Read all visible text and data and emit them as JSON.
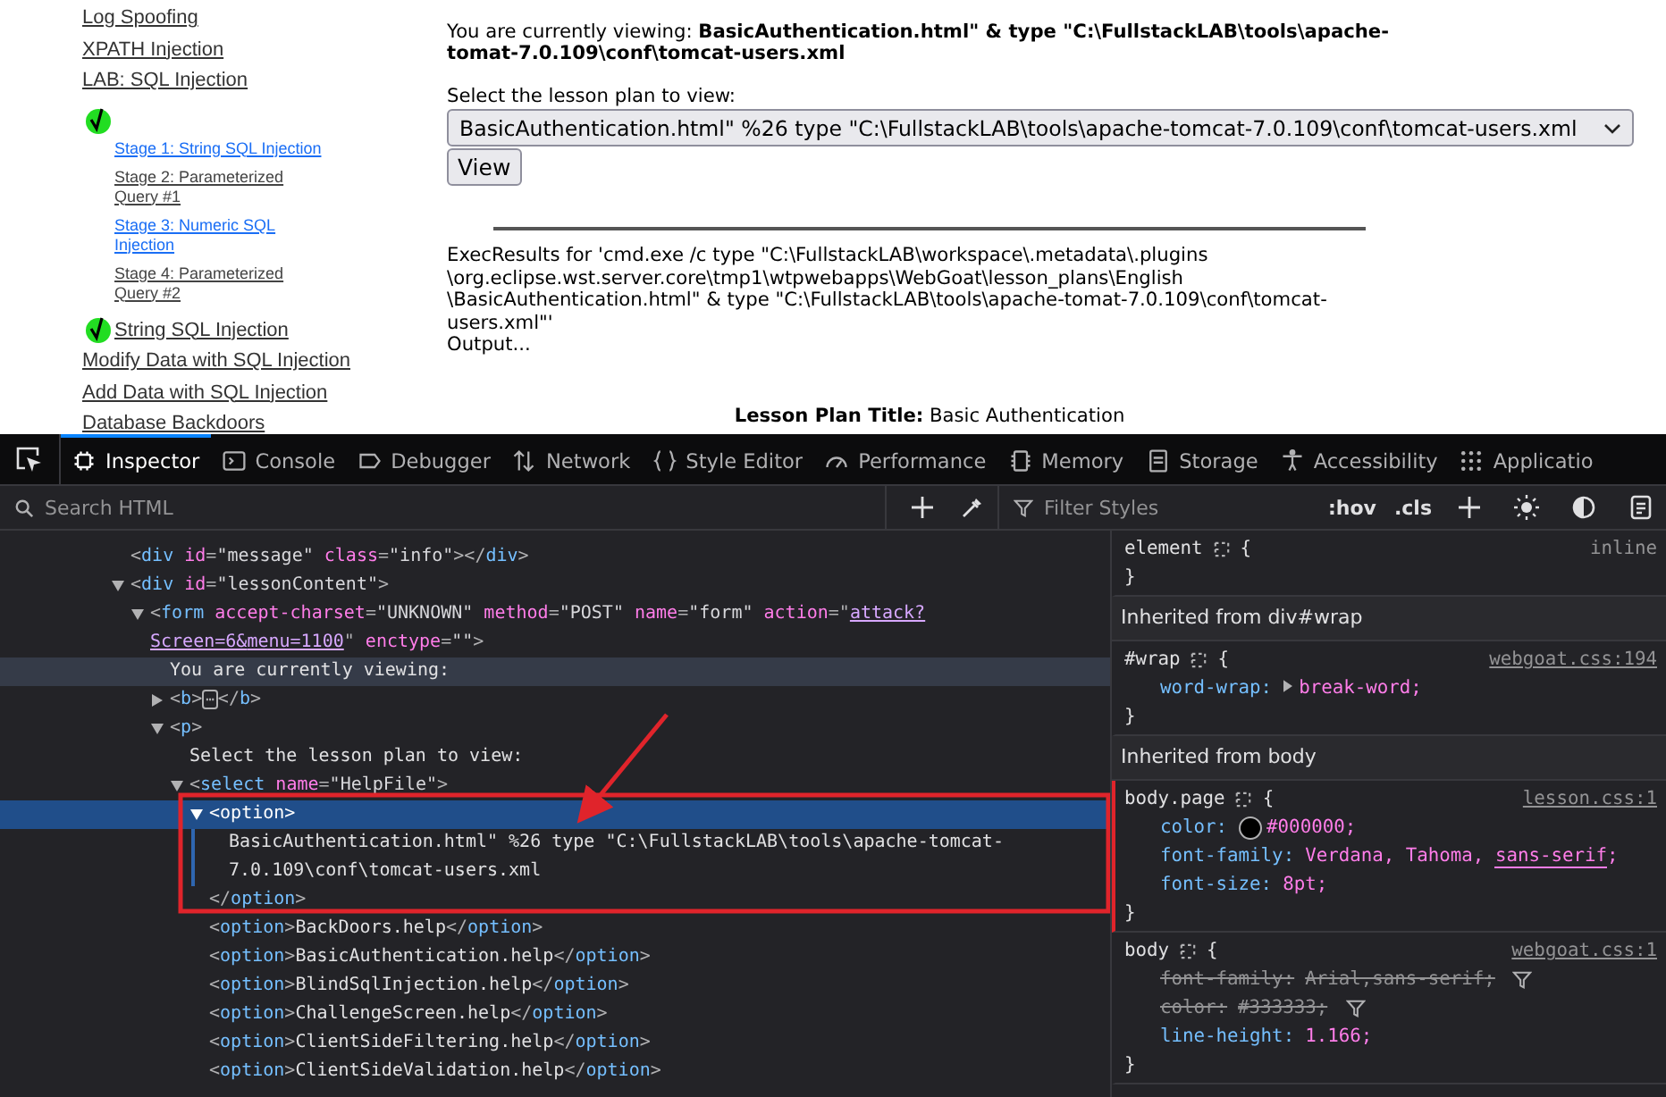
{
  "lesson_nav": {
    "items": [
      {
        "label": "Log Spoofing",
        "completed": false
      },
      {
        "label": "XPATH Injection",
        "completed": false
      },
      {
        "label": "LAB: SQL Injection",
        "completed": true,
        "children": [
          {
            "label": "Stage 1: String SQL Injection",
            "visited": false
          },
          {
            "label": "Stage 2: Parameterized Query #1",
            "visited": true
          },
          {
            "label": "Stage 3: Numeric SQL Injection",
            "visited": false
          },
          {
            "label": "Stage 4: Parameterized Query #2",
            "visited": true
          }
        ]
      },
      {
        "label": "String SQL Injection",
        "completed": true
      },
      {
        "label": "Modify Data with SQL Injection",
        "completed": false
      },
      {
        "label": "Add Data with SQL Injection",
        "completed": false
      },
      {
        "label": "Database Backdoors",
        "completed": false
      }
    ]
  },
  "lesson": {
    "viewing_label": "You are currently viewing:",
    "viewing_value": "BasicAuthentication.html\" & type \"C:\\FullstackLAB\\tools\\apache-tomat-7.0.109\\conf\\tomcat-users.xml",
    "select_label": "Select the lesson plan to view:",
    "select_value": "BasicAuthentication.html\" %26 type \"C:\\FullstackLAB\\tools\\apache-tomcat-7.0.109\\conf\\tomcat-users.xml",
    "view_button": "View",
    "exec_results": "ExecResults for 'cmd.exe /c type \"C:\\FullstackLAB\\workspace\\.metadata\\.plugins \\org.eclipse.wst.server.core\\tmp1\\wtpwebapps\\WebGoat\\lesson_plans\\English \\BasicAuthentication.html\" & type \"C:\\FullstackLAB\\tools\\apache-tomat-7.0.109\\conf\\tomcat-users.xml\"'",
    "output": "Output...",
    "title_label": "Lesson Plan Title:",
    "title_value": "Basic Authentication"
  },
  "devtools": {
    "tabs": [
      {
        "kind": "inspector",
        "label": "Inspector",
        "selected": true
      },
      {
        "kind": "console",
        "label": "Console",
        "selected": false
      },
      {
        "kind": "debugger",
        "label": "Debugger",
        "selected": false
      },
      {
        "kind": "network",
        "label": "Network",
        "selected": false
      },
      {
        "kind": "styles",
        "label": "Style Editor",
        "selected": false
      },
      {
        "kind": "performance",
        "label": "Performance",
        "selected": false
      },
      {
        "kind": "memory",
        "label": "Memory",
        "selected": false
      },
      {
        "kind": "storage",
        "label": "Storage",
        "selected": false
      },
      {
        "kind": "accessibility",
        "label": "Accessibility",
        "selected": false
      },
      {
        "kind": "application",
        "label": "Applicatio",
        "selected": false
      }
    ],
    "search": {
      "placeholder": "Search HTML"
    },
    "filter": {
      "placeholder": "Filter Styles"
    },
    "style_buttons": [
      ":hov",
      ".cls"
    ],
    "tree": [
      {
        "selected": false,
        "hovered": false,
        "line": [
          {
            "kind": "punct",
            "text": "<"
          },
          {
            "kind": "tag",
            "text": "div"
          },
          {
            "kind": "attr",
            "text": " id"
          },
          {
            "kind": "punct",
            "text": "="
          },
          {
            "kind": "value",
            "text": "\"message\""
          },
          {
            "kind": "attr",
            "text": " class"
          },
          {
            "kind": "punct",
            "text": "="
          },
          {
            "kind": "value",
            "text": "\"info\""
          },
          {
            "kind": "punct",
            "text": "></"
          },
          {
            "kind": "tag",
            "text": "div"
          },
          {
            "kind": "punct",
            "text": ">"
          }
        ]
      },
      {
        "selected": false,
        "hovered": false,
        "expanded": true,
        "line": [
          {
            "kind": "punct",
            "text": "<"
          },
          {
            "kind": "tag",
            "text": "div"
          },
          {
            "kind": "attr",
            "text": " id"
          },
          {
            "kind": "punct",
            "text": "="
          },
          {
            "kind": "value",
            "text": "\"lessonContent\""
          },
          {
            "kind": "punct",
            "text": ">"
          }
        ],
        "children": [
          {
            "selected": false,
            "hovered": false,
            "expanded": true,
            "line": [
              {
                "kind": "punct",
                "text": "<"
              },
              {
                "kind": "tag",
                "text": "form"
              },
              {
                "kind": "attr",
                "text": " accept-charset"
              },
              {
                "kind": "punct",
                "text": "="
              },
              {
                "kind": "value",
                "text": "\"UNKNOWN\""
              },
              {
                "kind": "attr",
                "text": " method"
              },
              {
                "kind": "punct",
                "text": "="
              },
              {
                "kind": "value",
                "text": "\"POST\""
              },
              {
                "kind": "attr",
                "text": " name"
              },
              {
                "kind": "punct",
                "text": "="
              },
              {
                "kind": "value",
                "text": "\"form\""
              },
              {
                "kind": "attr",
                "text": " action"
              },
              {
                "kind": "punct",
                "text": "=\""
              },
              {
                "kind": "link",
                "text": "attack?Screen=6&"
              },
              {
                "kind": "link",
                "text": "menu=1100"
              },
              {
                "kind": "punct",
                "text": "\""
              },
              {
                "kind": "attr",
                "text": " enctype"
              },
              {
                "kind": "punct",
                "text": "="
              },
              {
                "kind": "value",
                "text": "\"\""
              },
              {
                "kind": "punct",
                "text": ">"
              }
            ],
            "children": [
              {
                "selected": false,
                "hovered": true,
                "line": [
                  {
                    "kind": "text",
                    "text": "You are currently viewing:"
                  }
                ]
              },
              {
                "selected": false,
                "hovered": false,
                "expanded": false,
                "line": [
                  {
                    "kind": "punct",
                    "text": "<"
                  },
                  {
                    "kind": "tag",
                    "text": "b"
                  },
                  {
                    "kind": "punct",
                    "text": ">"
                  },
                  {
                    "kind": "badge",
                    "text": "⋯"
                  },
                  {
                    "kind": "punct",
                    "text": "</"
                  },
                  {
                    "kind": "tag",
                    "text": "b"
                  },
                  {
                    "kind": "punct",
                    "text": ">"
                  }
                ]
              },
              {
                "selected": false,
                "hovered": false,
                "expanded": true,
                "line": [
                  {
                    "kind": "punct",
                    "text": "<"
                  },
                  {
                    "kind": "tag",
                    "text": "p"
                  },
                  {
                    "kind": "punct",
                    "text": ">"
                  }
                ],
                "children": [
                  {
                    "selected": false,
                    "hovered": false,
                    "line": [
                      {
                        "kind": "text",
                        "text": "Select the lesson plan to view:"
                      }
                    ]
                  },
                  {
                    "selected": false,
                    "hovered": false,
                    "expanded": true,
                    "line": [
                      {
                        "kind": "punct",
                        "text": "<"
                      },
                      {
                        "kind": "tag",
                        "text": "select"
                      },
                      {
                        "kind": "attr",
                        "text": " name"
                      },
                      {
                        "kind": "punct",
                        "text": "="
                      },
                      {
                        "kind": "value",
                        "text": "\"HelpFile\""
                      },
                      {
                        "kind": "punct",
                        "text": ">"
                      }
                    ],
                    "children": [
                      {
                        "selected": true,
                        "hovered": false,
                        "expanded": true,
                        "line": [
                          {
                            "kind": "punct",
                            "text": "<"
                          },
                          {
                            "kind": "tag",
                            "text": "option"
                          },
                          {
                            "kind": "punct",
                            "text": ">"
                          }
                        ],
                        "children": [
                          {
                            "selected": false,
                            "hovered": false,
                            "line": [
                              {
                                "kind": "text",
                                "text": "BasicAuthentication.html\" %26 type \"C:\\FullstackLAB\\tools\\apache-tomcat-7.0.109\\conf\\tomcat-users.xml"
                              }
                            ]
                          }
                        ],
                        "close": [
                          {
                            "kind": "punct",
                            "text": "</"
                          },
                          {
                            "kind": "tag",
                            "text": "option"
                          },
                          {
                            "kind": "punct",
                            "text": ">"
                          }
                        ]
                      },
                      {
                        "selected": false,
                        "hovered": false,
                        "line": [
                          {
                            "kind": "punct",
                            "text": "<"
                          },
                          {
                            "kind": "tag",
                            "text": "option"
                          },
                          {
                            "kind": "punct",
                            "text": ">"
                          },
                          {
                            "kind": "text",
                            "text": "BackDoors.help"
                          },
                          {
                            "kind": "punct",
                            "text": "</"
                          },
                          {
                            "kind": "tag",
                            "text": "option"
                          },
                          {
                            "kind": "punct",
                            "text": ">"
                          }
                        ]
                      },
                      {
                        "selected": false,
                        "hovered": false,
                        "line": [
                          {
                            "kind": "punct",
                            "text": "<"
                          },
                          {
                            "kind": "tag",
                            "text": "option"
                          },
                          {
                            "kind": "punct",
                            "text": ">"
                          },
                          {
                            "kind": "text",
                            "text": "BasicAuthentication.help"
                          },
                          {
                            "kind": "punct",
                            "text": "</"
                          },
                          {
                            "kind": "tag",
                            "text": "option"
                          },
                          {
                            "kind": "punct",
                            "text": ">"
                          }
                        ]
                      },
                      {
                        "selected": false,
                        "hovered": false,
                        "line": [
                          {
                            "kind": "punct",
                            "text": "<"
                          },
                          {
                            "kind": "tag",
                            "text": "option"
                          },
                          {
                            "kind": "punct",
                            "text": ">"
                          },
                          {
                            "kind": "text",
                            "text": "BlindSqlInjection.help"
                          },
                          {
                            "kind": "punct",
                            "text": "</"
                          },
                          {
                            "kind": "tag",
                            "text": "option"
                          },
                          {
                            "kind": "punct",
                            "text": ">"
                          }
                        ]
                      },
                      {
                        "selected": false,
                        "hovered": false,
                        "line": [
                          {
                            "kind": "punct",
                            "text": "<"
                          },
                          {
                            "kind": "tag",
                            "text": "option"
                          },
                          {
                            "kind": "punct",
                            "text": ">"
                          },
                          {
                            "kind": "text",
                            "text": "ChallengeScreen.help"
                          },
                          {
                            "kind": "punct",
                            "text": "</"
                          },
                          {
                            "kind": "tag",
                            "text": "option"
                          },
                          {
                            "kind": "punct",
                            "text": ">"
                          }
                        ]
                      },
                      {
                        "selected": false,
                        "hovered": false,
                        "line": [
                          {
                            "kind": "punct",
                            "text": "<"
                          },
                          {
                            "kind": "tag",
                            "text": "option"
                          },
                          {
                            "kind": "punct",
                            "text": ">"
                          },
                          {
                            "kind": "text",
                            "text": "ClientSideFiltering.help"
                          },
                          {
                            "kind": "punct",
                            "text": "</"
                          },
                          {
                            "kind": "tag",
                            "text": "option"
                          },
                          {
                            "kind": "punct",
                            "text": ">"
                          }
                        ]
                      },
                      {
                        "selected": false,
                        "hovered": false,
                        "line": [
                          {
                            "kind": "punct",
                            "text": "<"
                          },
                          {
                            "kind": "tag",
                            "text": "option"
                          },
                          {
                            "kind": "punct",
                            "text": ">"
                          },
                          {
                            "kind": "text",
                            "text": "ClientSideValidation.help"
                          },
                          {
                            "kind": "punct",
                            "text": "</"
                          },
                          {
                            "kind": "tag",
                            "text": "option"
                          },
                          {
                            "kind": "punct",
                            "text": ">"
                          }
                        ]
                      }
                    ]
                  }
                ]
              }
            ]
          }
        ]
      }
    ],
    "rules": [
      {
        "kind": "rule",
        "selector": "element",
        "open": "{",
        "close": "}",
        "source": "inline",
        "source_link": false,
        "flagged": false
      },
      {
        "kind": "header",
        "text": "Inherited from div#wrap"
      },
      {
        "kind": "rule",
        "selector": "#wrap",
        "open": "{",
        "close": "}",
        "source": "webgoat.css:194",
        "source_link": true,
        "flagged": false,
        "declarations": [
          {
            "property": "word-wrap:",
            "expander": true,
            "overridden": false,
            "swatch": false,
            "value": [
              {
                "text": "break-word",
                "underlined": false
              },
              {
                "text": ";",
                "underlined": false
              }
            ]
          }
        ]
      },
      {
        "kind": "header",
        "text": "Inherited from body"
      },
      {
        "kind": "rule",
        "selector": "body.page",
        "open": "{",
        "close": "}",
        "source": "lesson.css:1",
        "source_link": true,
        "flagged": true,
        "declarations": [
          {
            "property": "color:",
            "expander": false,
            "overridden": false,
            "swatch": true,
            "value": [
              {
                "text": "#000000",
                "underlined": false
              },
              {
                "text": ";",
                "underlined": false
              }
            ]
          },
          {
            "property": "font-family:",
            "expander": false,
            "overridden": false,
            "swatch": false,
            "value": [
              {
                "text": "Verdana, Tahoma, ",
                "underlined": false
              },
              {
                "text": "sans-serif",
                "underlined": true
              },
              {
                "text": ";",
                "underlined": false
              }
            ]
          },
          {
            "property": "font-size:",
            "expander": false,
            "overridden": false,
            "swatch": false,
            "value": [
              {
                "text": "8pt",
                "underlined": false
              },
              {
                "text": ";",
                "underlined": false
              }
            ]
          }
        ]
      },
      {
        "kind": "rule",
        "selector": "body",
        "open": "{",
        "close": "}",
        "source": "webgoat.css:1",
        "source_link": true,
        "flagged": false,
        "declarations": [
          {
            "property": "font-family:",
            "expander": false,
            "overridden": true,
            "swatch": false,
            "value": [
              {
                "text": "Arial,sans-serif",
                "underlined": false
              },
              {
                "text": ";",
                "underlined": false
              }
            ]
          },
          {
            "property": "color:",
            "expander": false,
            "overridden": true,
            "swatch": false,
            "value": [
              {
                "text": "#333333",
                "underlined": false
              },
              {
                "text": ";",
                "underlined": false
              }
            ]
          },
          {
            "property": "line-height:",
            "expander": false,
            "overridden": false,
            "swatch": false,
            "value": [
              {
                "text": "1.166",
                "underlined": false
              },
              {
                "text": ";",
                "underlined": false
              }
            ]
          }
        ]
      }
    ]
  }
}
